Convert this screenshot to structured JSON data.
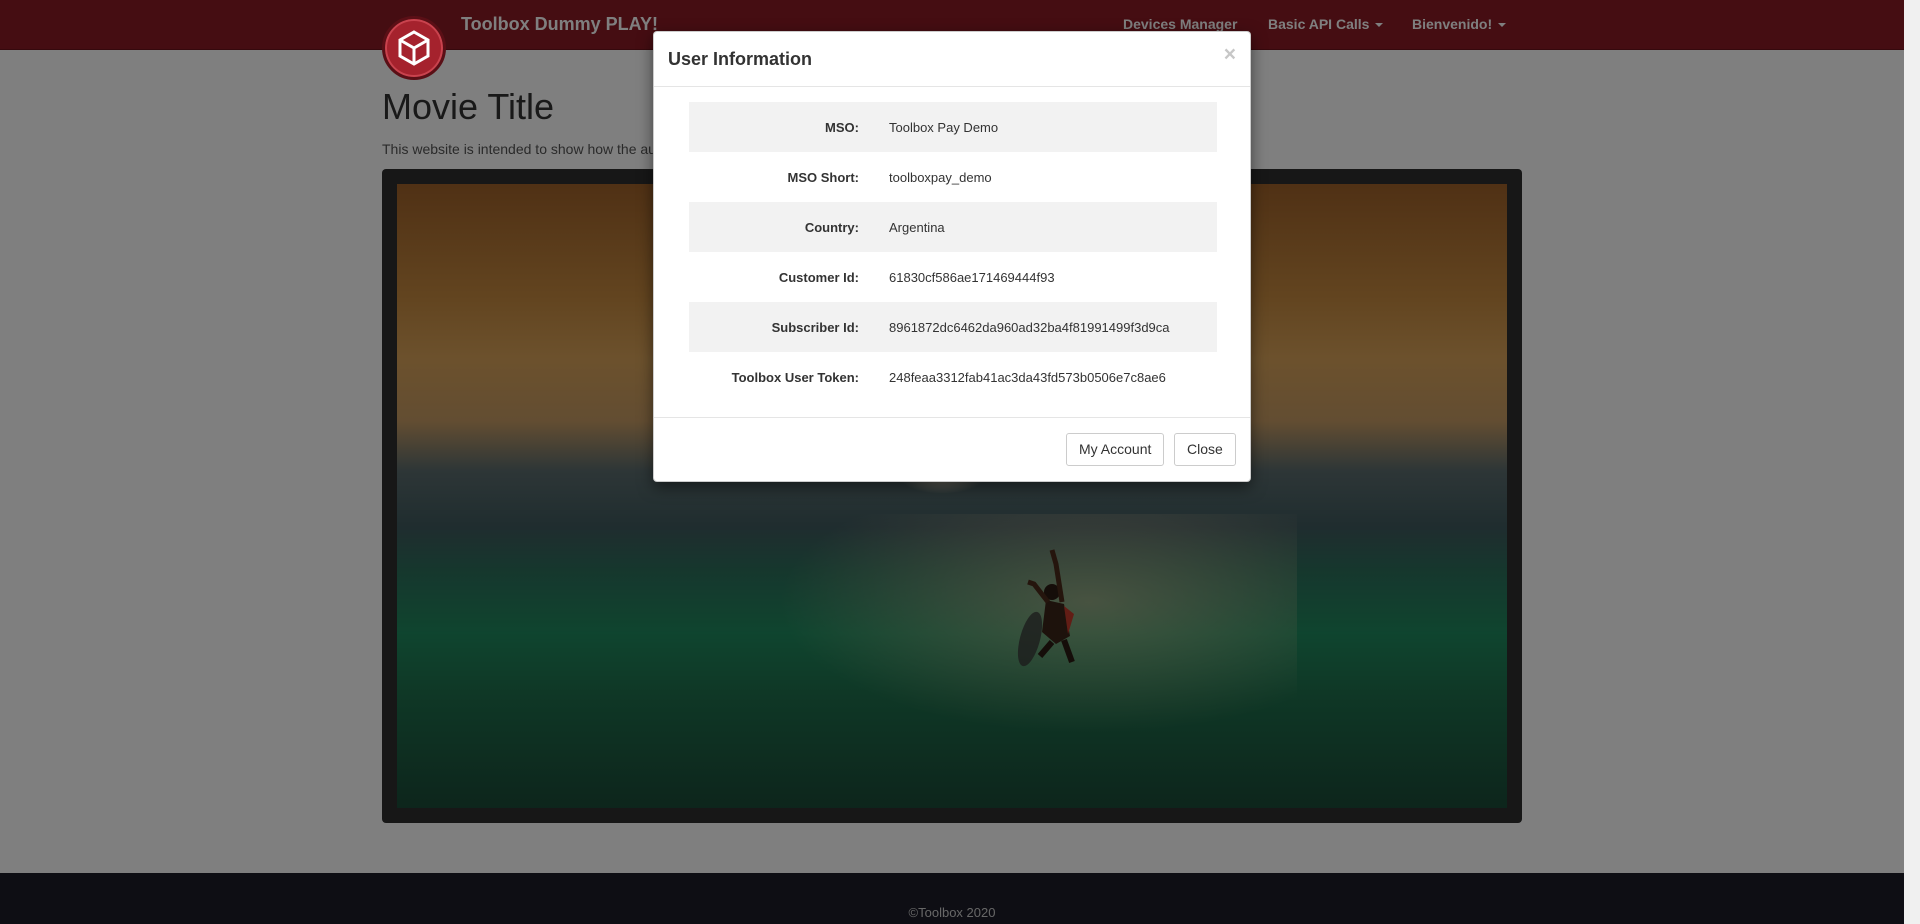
{
  "navbar": {
    "brand_title": "Toolbox Dummy PLAY!",
    "links": [
      "Devices Manager",
      "Basic API Calls",
      "Bienvenido!"
    ],
    "bg_color": "#8b1a24"
  },
  "main": {
    "title": "Movie Title",
    "description": "This website is intended to show how the au"
  },
  "modal": {
    "title": "User Information",
    "close_glyph": "×",
    "rows": [
      {
        "label": "MSO:",
        "value": "Toolbox Pay Demo"
      },
      {
        "label": "MSO Short:",
        "value": "toolboxpay_demo"
      },
      {
        "label": "Country:",
        "value": "Argentina"
      },
      {
        "label": "Customer Id:",
        "value": "61830cf586ae171469444f93"
      },
      {
        "label": "Subscriber Id:",
        "value": "8961872dc6462da960ad32ba4f81991499f3d9ca"
      },
      {
        "label": "Toolbox User Token:",
        "value": "248feaa3312fab41ac3da43fd573b0506e7c8ae6"
      }
    ],
    "buttons": {
      "my_account": "My Account",
      "close": "Close"
    }
  },
  "footer": {
    "text": "©Toolbox 2020"
  },
  "icons": {
    "brand_logo": "cube-icon"
  }
}
